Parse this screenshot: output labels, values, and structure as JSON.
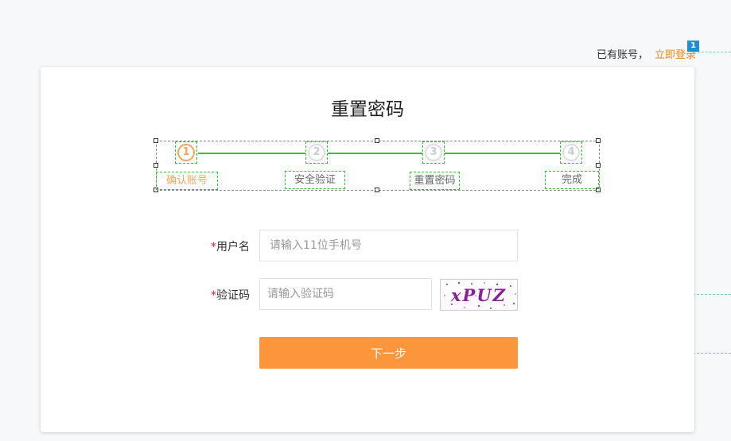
{
  "header": {
    "has_account_text": "已有账号，",
    "login_link": "立即登录",
    "annotation_badge": "1"
  },
  "page": {
    "title": "重置密码"
  },
  "steps": [
    {
      "number": "1",
      "label": "确认账号",
      "active": true
    },
    {
      "number": "2",
      "label": "安全验证",
      "active": false
    },
    {
      "number": "3",
      "label": "重置密码",
      "active": false
    },
    {
      "number": "4",
      "label": "完成",
      "active": false
    }
  ],
  "form": {
    "required_mark": "*",
    "username": {
      "label": "用户名",
      "value": "",
      "placeholder": "请输入11位手机号"
    },
    "captcha": {
      "label": "验证码",
      "value": "",
      "placeholder": "请输入验证码",
      "image_text": "xPUZ"
    },
    "next_button": "下一步"
  },
  "colors": {
    "accent": "#fb963c",
    "link": "#f08519",
    "step_active": "#f7a55a",
    "step_line": "#2ec82e",
    "required": "#e02020",
    "badge": "#1e8fd6"
  }
}
